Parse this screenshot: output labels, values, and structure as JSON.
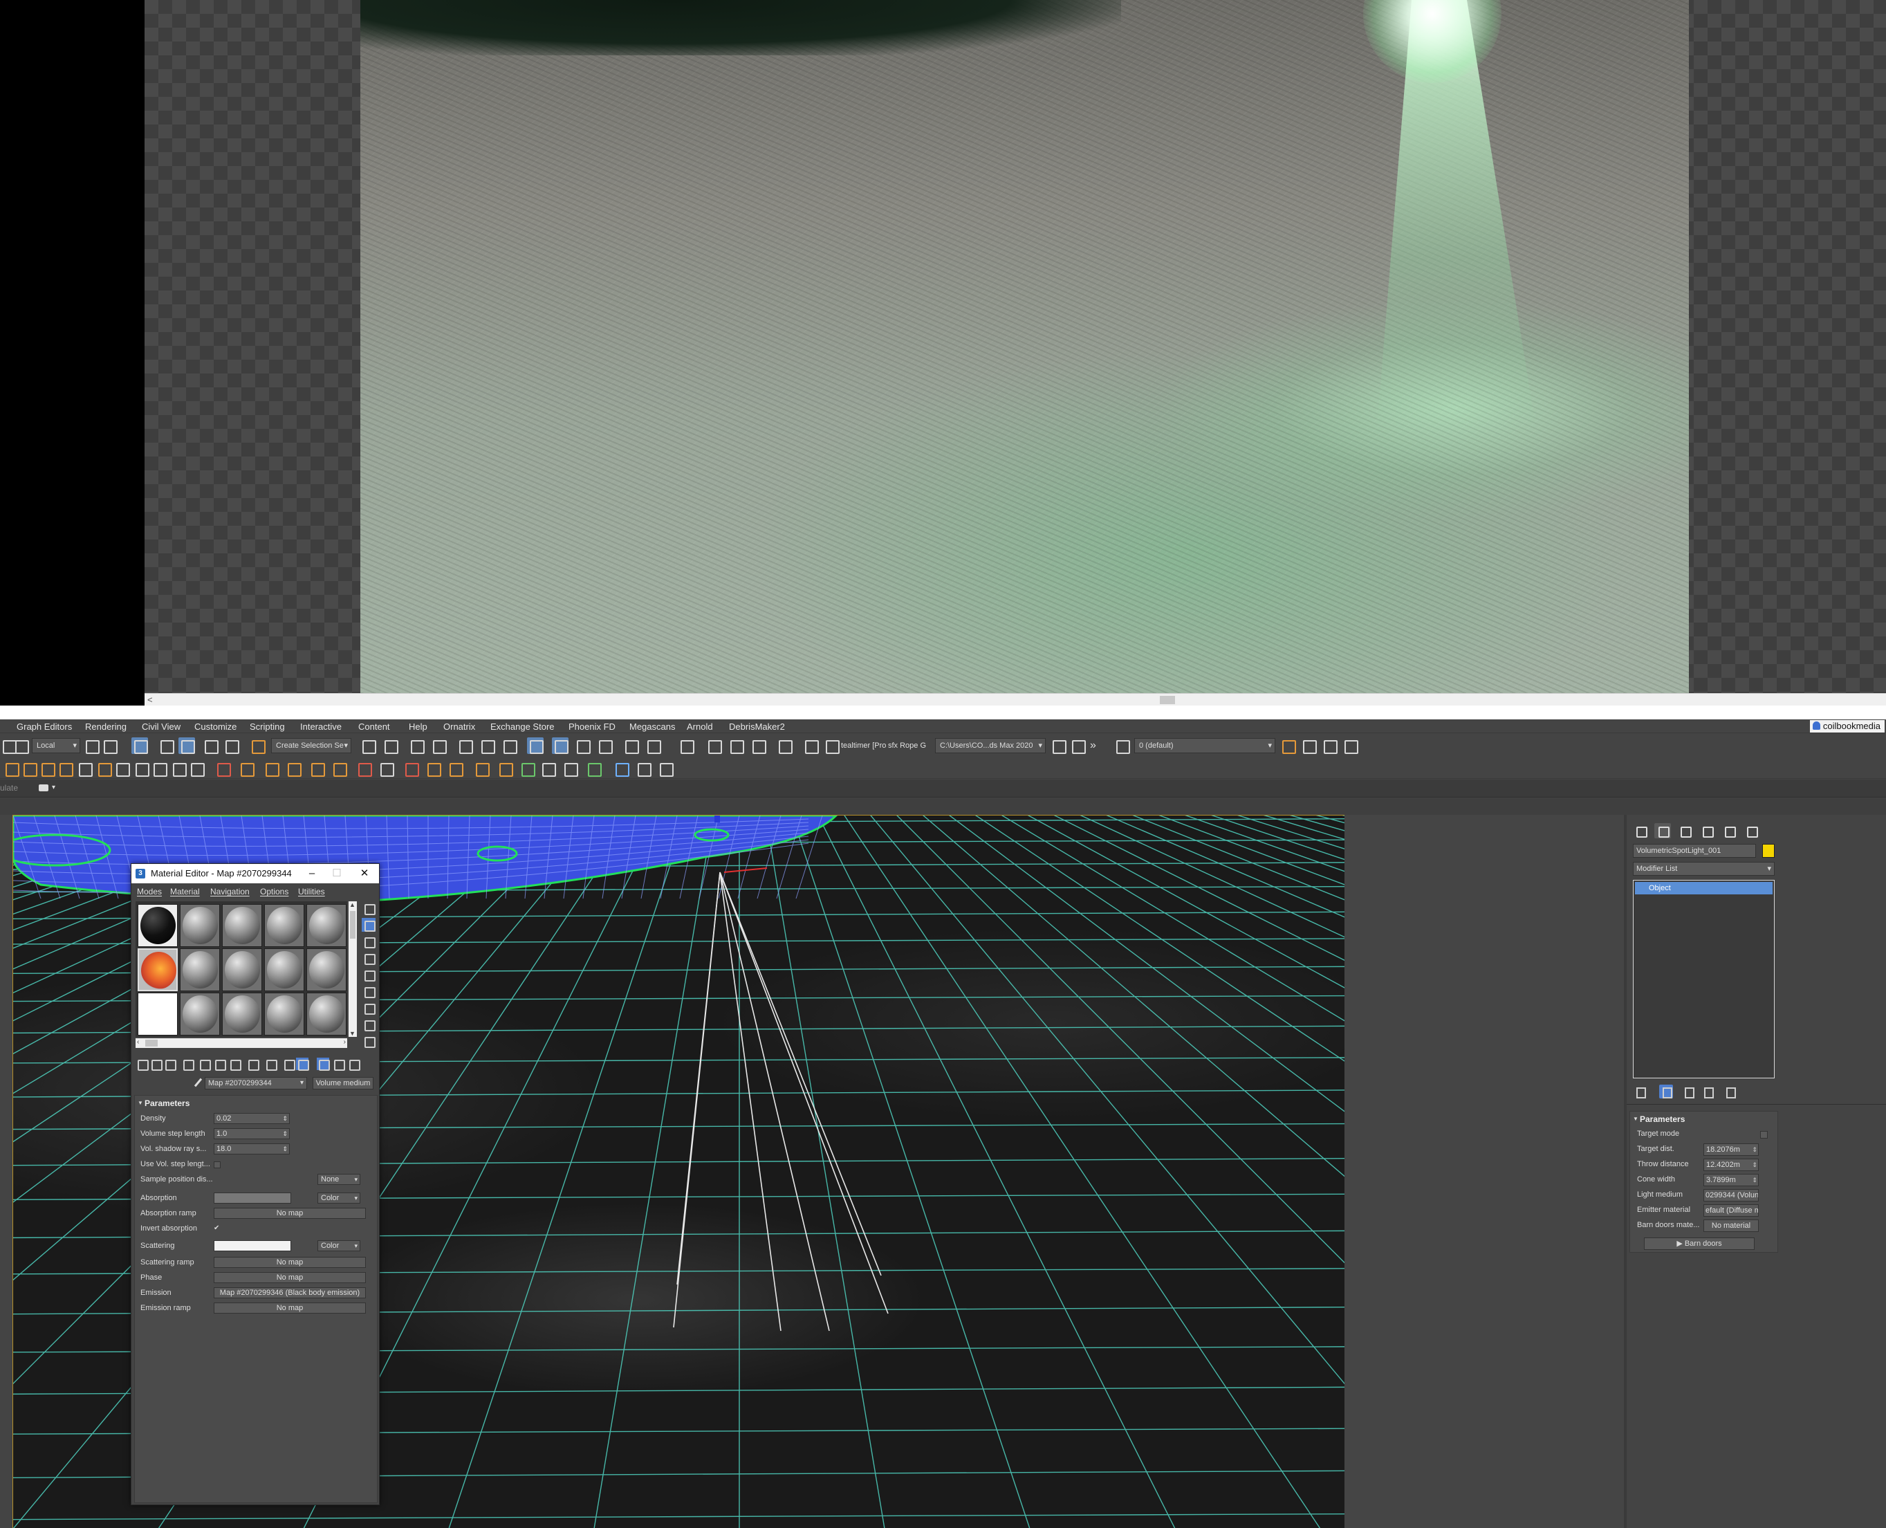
{
  "render_window": {
    "scroll_left_arrow": "<"
  },
  "menubar": {
    "items": [
      "Graph Editors",
      "Rendering",
      "Civil View",
      "Customize",
      "Scripting",
      "Interactive",
      "Content",
      "Help",
      "Ornatrix",
      "Exchange Store",
      "Phoenix FD",
      "Megascans",
      "Arnold",
      "DebrisMaker2"
    ],
    "user": "coilbookmedia"
  },
  "toolbar": {
    "reference_coord": "Local",
    "selection_set": "Create Selection Se",
    "script_label": "tealtimer [Pro",
    "script_label2": "sfx Rope G",
    "project_path": "C:\\Users\\CO...ds Max 2020",
    "layer": "0 (default)"
  },
  "ribbon": {
    "label": "ulate"
  },
  "command_panel": {
    "object_name": "VolumetricSpotLight_001",
    "object_color": "#f5d500",
    "modifier_list": "Modifier List",
    "stack_item": "Object",
    "params": {
      "title": "Parameters",
      "target_mode": "Target mode",
      "target_dist_label": "Target dist.",
      "target_dist_value": "18.2076m",
      "throw_distance_label": "Throw distance",
      "throw_distance_value": "12.4202m",
      "cone_width_label": "Cone width",
      "cone_width_value": "3.7899m",
      "light_medium_label": "Light medium",
      "light_medium_value": "0299344 (Volun",
      "emitter_material_label": "Emitter material",
      "emitter_material_value": "efault (Diffuse m",
      "barn_doors_mat_label": "Barn doors mate...",
      "barn_doors_mat_value": "No material",
      "barn_doors_button": "▶ Barn doors"
    }
  },
  "material_editor": {
    "title": "Material Editor - Map #2070299344",
    "menus": [
      "Modes",
      "Material",
      "Navigation",
      "Options",
      "Utilities"
    ],
    "map_name": "Map #2070299344",
    "map_type": "Volume medium",
    "params": {
      "title": "Parameters",
      "density_label": "Density",
      "density_value": "0.02",
      "vol_step_label": "Volume step length",
      "vol_step_value": "1.0",
      "vol_shadow_label": "Vol. shadow ray s...",
      "vol_shadow_value": "18.0",
      "use_vol_step_label": "Use Vol. step lengt...",
      "sample_pos_label": "Sample position dis...",
      "sample_pos_value": "None",
      "absorption_label": "Absorption",
      "absorption_color": "#787878",
      "absorption_mode": "Color",
      "absorption_ramp_label": "Absorption ramp",
      "absorption_ramp_value": "No map",
      "invert_absorption_label": "Invert absorption",
      "invert_absorption_check": "✔",
      "scattering_label": "Scattering",
      "scattering_color": "#f2f2f2",
      "scattering_mode": "Color",
      "scattering_ramp_label": "Scattering ramp",
      "scattering_ramp_value": "No map",
      "phase_label": "Phase",
      "phase_value": "No map",
      "emission_label": "Emission",
      "emission_value": "Map #2070299346 (Black body emission)",
      "emission_ramp_label": "Emission ramp",
      "emission_ramp_value": "No map"
    }
  }
}
